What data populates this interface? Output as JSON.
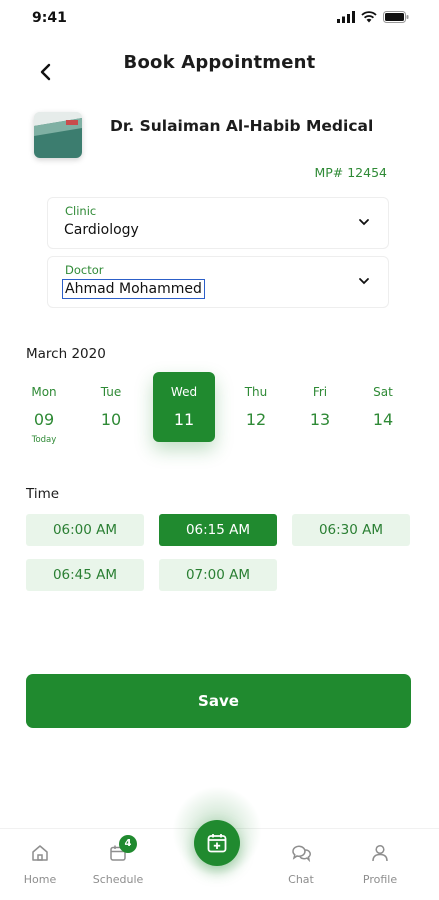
{
  "status": {
    "time": "9:41"
  },
  "header": {
    "title": "Book Appointment"
  },
  "provider": {
    "name": "Dr. Sulaiman Al-Habib Medical",
    "mp": "MP# 12454"
  },
  "clinic": {
    "label": "Clinic",
    "value": "Cardiology"
  },
  "doctor": {
    "label": "Doctor",
    "value": "Ahmad Mohammed"
  },
  "calendar": {
    "month": "March 2020",
    "days": [
      {
        "name": "Mon",
        "num": "09",
        "note": "Today",
        "selected": false
      },
      {
        "name": "Tue",
        "num": "10",
        "note": "",
        "selected": false
      },
      {
        "name": "Wed",
        "num": "11",
        "note": "",
        "selected": true
      },
      {
        "name": "Thu",
        "num": "12",
        "note": "",
        "selected": false
      },
      {
        "name": "Fri",
        "num": "13",
        "note": "",
        "selected": false
      },
      {
        "name": "Sat",
        "num": "14",
        "note": "",
        "selected": false
      }
    ]
  },
  "time": {
    "label": "Time",
    "slots": [
      {
        "label": "06:00 AM",
        "selected": false
      },
      {
        "label": "06:15 AM",
        "selected": true
      },
      {
        "label": "06:30 AM",
        "selected": false
      },
      {
        "label": "06:45 AM",
        "selected": false
      },
      {
        "label": "07:00 AM",
        "selected": false
      }
    ]
  },
  "save_label": "Save",
  "nav": {
    "home": "Home",
    "schedule": "Schedule",
    "schedule_badge": "4",
    "chat": "Chat",
    "profile": "Profile"
  },
  "colors": {
    "accent": "#208a2f",
    "accent_light": "#e9f5ea"
  }
}
